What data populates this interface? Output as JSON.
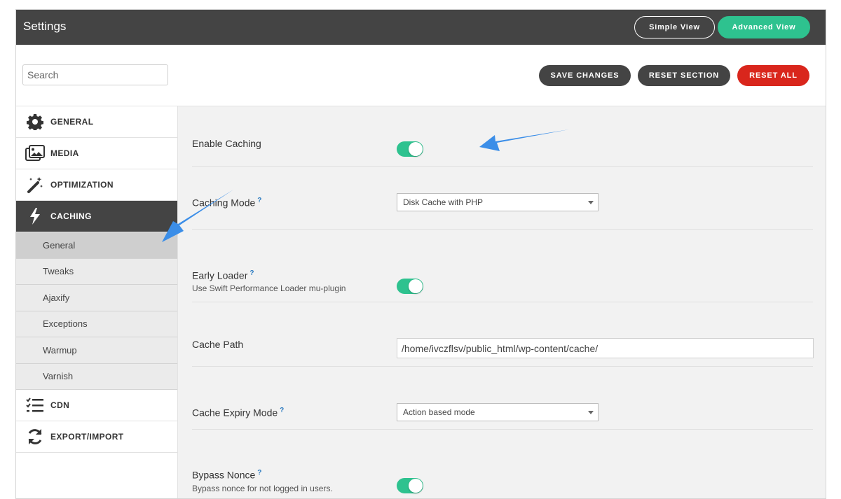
{
  "header": {
    "title": "Settings",
    "simple_view": "Simple View",
    "advanced_view": "Advanced View"
  },
  "toolbar": {
    "search_placeholder": "Search",
    "save_changes": "SAVE CHANGES",
    "reset_section": "RESET SECTION",
    "reset_all": "RESET ALL"
  },
  "sidebar": {
    "items": [
      {
        "label": "GENERAL",
        "icon": "gear-icon"
      },
      {
        "label": "MEDIA",
        "icon": "images-icon"
      },
      {
        "label": "OPTIMIZATION",
        "icon": "magic-wand-icon"
      },
      {
        "label": "CACHING",
        "icon": "bolt-icon",
        "active": true
      },
      {
        "label": "CDN",
        "icon": "list-check-icon"
      },
      {
        "label": "EXPORT/IMPORT",
        "icon": "sync-icon"
      }
    ],
    "caching_sub": [
      "General",
      "Tweaks",
      "Ajaxify",
      "Exceptions",
      "Warmup",
      "Varnish"
    ],
    "active_sub": "General"
  },
  "settings": {
    "enable_caching": {
      "label": "Enable Caching",
      "enabled": true
    },
    "caching_mode": {
      "label": "Caching Mode",
      "help": "?",
      "value": "Disk Cache with PHP"
    },
    "early_loader": {
      "label": "Early Loader",
      "help": "?",
      "description": "Use Swift Performance Loader mu-plugin",
      "enabled": true
    },
    "cache_path": {
      "label": "Cache Path",
      "value": "/home/ivczflsv/public_html/wp-content/cache/"
    },
    "cache_expiry_mode": {
      "label": "Cache Expiry Mode",
      "help": "?",
      "value": "Action based mode"
    },
    "bypass_nonce": {
      "label": "Bypass Nonce",
      "help": "?",
      "description": "Bypass nonce for not logged in users.",
      "enabled": true
    }
  },
  "colors": {
    "header_bg": "#444444",
    "accent_green": "#2ec28f",
    "danger_red": "#d9261c",
    "annotation_blue": "#3b8ee8"
  }
}
